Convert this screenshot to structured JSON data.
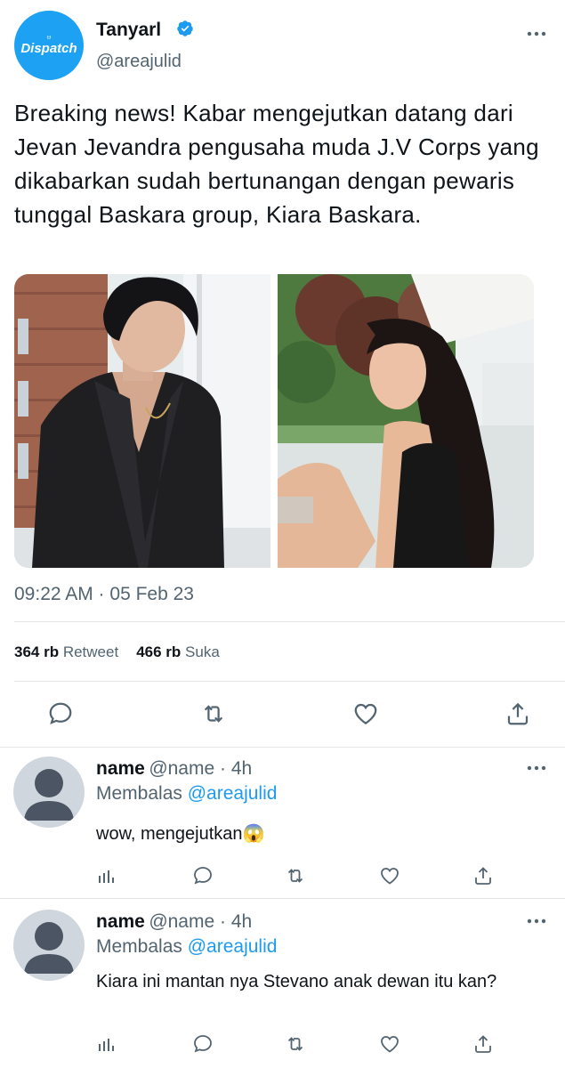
{
  "tweet": {
    "author_name": "Tanyarl",
    "author_handle": "@areajulid",
    "avatar_logo_top": "Ɵ",
    "avatar_logo": "Dispatch",
    "text": "Breaking news! Kabar mengejutkan datang dari Jevan Jevandra pengusaha muda J.V Corps yang dikabarkan sudah bertunangan dengan pewaris tunggal Baskara group, Kiara Baskara.",
    "timestamp": "09:22 AM · 05 Feb 23",
    "retweets_count": "364 rb",
    "retweets_label": "Retweet",
    "likes_count": "466 rb",
    "likes_label": "Suka",
    "verified_icon": "verified-badge-icon",
    "more_icon": "more-dots-icon"
  },
  "actions": [
    "reply-icon",
    "retweet-icon",
    "like-icon",
    "share-icon"
  ],
  "replies": [
    {
      "name": "name",
      "handle_time": "@name · 4h",
      "replying_prefix": "Membalas",
      "replying_to": "@areajulid",
      "text": "wow, mengejutkan😱"
    },
    {
      "name": "name",
      "handle_time": "@name · 4h",
      "replying_prefix": "Membalas",
      "replying_to": "@areajulid",
      "text": "Kiara ini mantan nya Stevano anak dewan itu kan?"
    }
  ],
  "reply_actions": [
    "analytics-icon",
    "reply-icon",
    "retweet-icon",
    "like-icon",
    "share-icon"
  ],
  "colors": {
    "accent": "#1d9bf0",
    "secondary_text": "#536471",
    "primary_text": "#0f1419",
    "avatar_bg": "#1da1f2",
    "divider": "#e2e6e9"
  }
}
